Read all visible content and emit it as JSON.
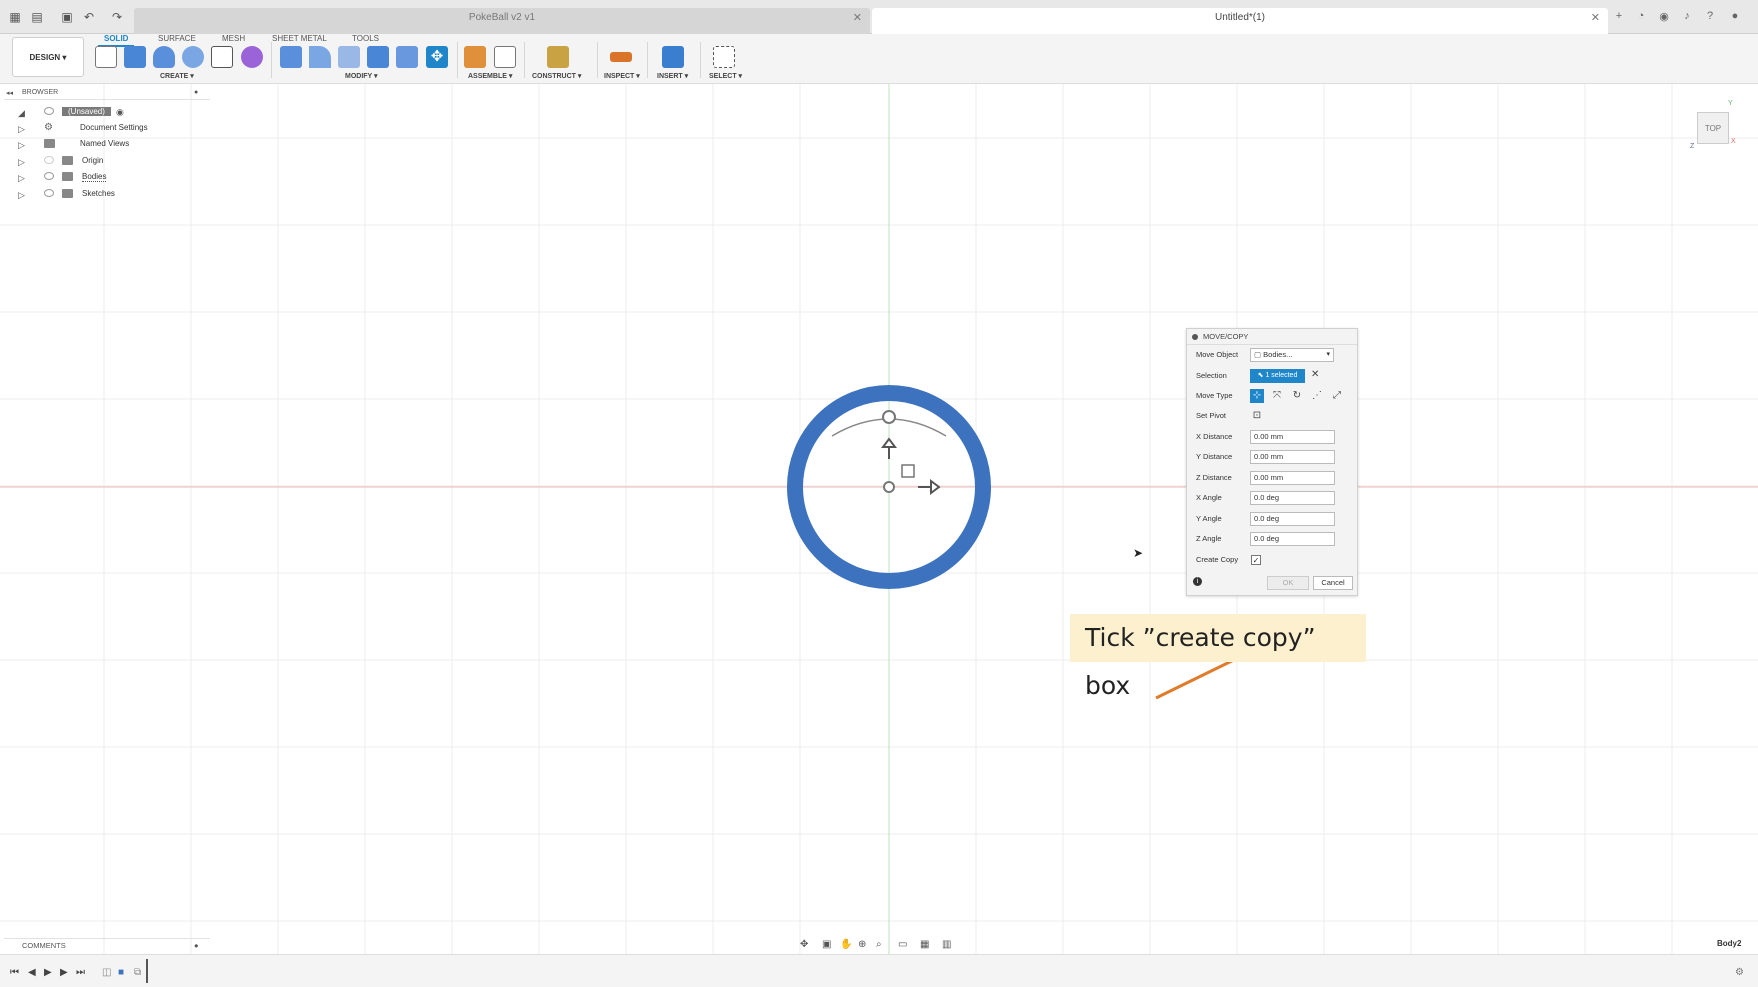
{
  "app": {
    "tabs": [
      {
        "label": "PokeBall v2 v1",
        "active": false
      },
      {
        "label": "Untitled*(1)",
        "active": true
      }
    ]
  },
  "ribbon": {
    "workspace": "DESIGN ▾",
    "tabs": [
      "SOLID",
      "SURFACE",
      "MESH",
      "SHEET METAL",
      "TOOLS"
    ],
    "groups": [
      "CREATE ▾",
      "MODIFY ▾",
      "ASSEMBLE ▾",
      "CONSTRUCT ▾",
      "INSPECT ▾",
      "INSERT ▾",
      "SELECT ▾"
    ]
  },
  "browser": {
    "title": "BROWSER",
    "root": "(Unsaved)",
    "items": [
      "Document Settings",
      "Named Views",
      "Origin",
      "Bodies",
      "Sketches"
    ]
  },
  "viewcube": {
    "face": "TOP",
    "axis_y": "Y",
    "axis_x": "X",
    "axis_z": "Z"
  },
  "dialog": {
    "title": "MOVE/COPY",
    "fields": {
      "move_object_label": "Move Object",
      "move_object_value": "Bodies...",
      "selection_label": "Selection",
      "selection_value": "1 selected",
      "move_type_label": "Move Type",
      "set_pivot_label": "Set Pivot",
      "x_distance_label": "X Distance",
      "x_distance_value": "0.00 mm",
      "y_distance_label": "Y Distance",
      "y_distance_value": "0.00 mm",
      "z_distance_label": "Z Distance",
      "z_distance_value": "0.00 mm",
      "x_angle_label": "X Angle",
      "x_angle_value": "0.0 deg",
      "y_angle_label": "Y Angle",
      "y_angle_value": "0.0 deg",
      "z_angle_label": "Z Angle",
      "z_angle_value": "0.0 deg",
      "create_copy_label": "Create Copy",
      "create_copy_checked": true
    },
    "ok": "OK",
    "cancel": "Cancel"
  },
  "callout": {
    "text": "Tick ”create copy” box",
    "color": "#e07b2a"
  },
  "comments": {
    "title": "COMMENTS"
  },
  "status": {
    "body": "Body2"
  },
  "colors": {
    "accent": "#1f86c9",
    "ring": "#3d72be",
    "axis_red": "#e8a0a0",
    "axis_green": "#a8dca8"
  }
}
